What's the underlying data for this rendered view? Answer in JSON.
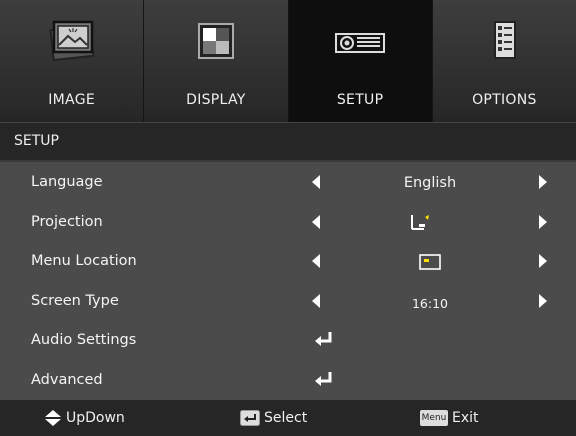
{
  "tabs": [
    {
      "label": "IMAGE",
      "icon": "image-icon",
      "active": false
    },
    {
      "label": "DISPLAY",
      "icon": "display-icon",
      "active": false
    },
    {
      "label": "SETUP",
      "icon": "setup-icon",
      "active": true
    },
    {
      "label": "OPTIONS",
      "icon": "options-icon",
      "active": false
    }
  ],
  "section": {
    "title": "SETUP"
  },
  "menu": {
    "language": {
      "label": "Language",
      "value": "English"
    },
    "projection": {
      "label": "Projection",
      "value_icon": "front-desktop-projection-icon"
    },
    "menu_location": {
      "label": "Menu Location",
      "value_icon": "center-location-icon"
    },
    "screen_type": {
      "label": "Screen Type",
      "value": "16:10"
    },
    "audio_settings": {
      "label": "Audio Settings",
      "action_icon": "enter-icon"
    },
    "advanced": {
      "label": "Advanced",
      "action_icon": "enter-icon"
    }
  },
  "footer": {
    "updown": "UpDown",
    "select": "Select",
    "exit": "Exit",
    "menu_key": "Menu"
  },
  "colors": {
    "accent_yellow": "#ffe000",
    "active_tab": "#0e0e0e",
    "row_bg": "#4b4b4b"
  }
}
